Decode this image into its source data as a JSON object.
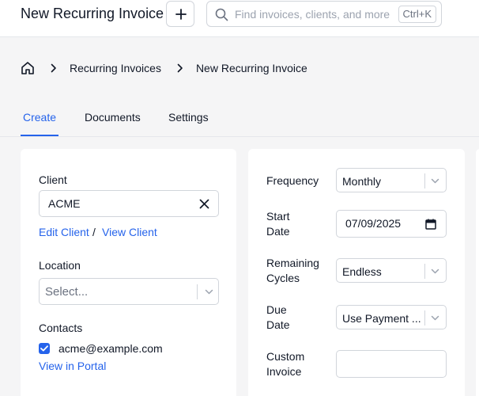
{
  "header": {
    "title": "New Recurring Invoice",
    "search_placeholder": "Find invoices, clients, and more",
    "search_shortcut": "Ctrl+K"
  },
  "breadcrumb": {
    "items": [
      "Recurring Invoices",
      "New Recurring Invoice"
    ]
  },
  "tabs": [
    {
      "label": "Create",
      "active": true
    },
    {
      "label": "Documents",
      "active": false
    },
    {
      "label": "Settings",
      "active": false
    }
  ],
  "client_section": {
    "client_label": "Client",
    "client_value": "ACME",
    "edit_client": "Edit Client",
    "separator": "/",
    "view_client": "View Client",
    "location_label": "Location",
    "location_placeholder": "Select...",
    "contacts_label": "Contacts",
    "contact_email": "acme@example.com",
    "contact_checked": true,
    "view_portal": "View in Portal"
  },
  "schedule_section": {
    "frequency_label": "Frequency",
    "frequency_value": "Monthly",
    "start_date_label_1": "Start",
    "start_date_label_2": "Date",
    "start_date_value": "07/09/2025",
    "remaining_label_1": "Remaining",
    "remaining_label_2": "Cycles",
    "remaining_value": "Endless",
    "due_label_1": "Due",
    "due_label_2": "Date",
    "due_value": "Use Payment ...",
    "custom_label_1": "Custom",
    "custom_label_2": "Invoice",
    "custom_value": ""
  },
  "colors": {
    "accent": "#2563eb",
    "background": "#f5f5f6",
    "card": "#ffffff",
    "border": "#d1d5db"
  },
  "icons": [
    "plus-icon",
    "search-icon",
    "home-icon",
    "chevron-right-icon",
    "close-icon",
    "chevron-down-icon",
    "checkmark-icon",
    "calendar-icon"
  ]
}
